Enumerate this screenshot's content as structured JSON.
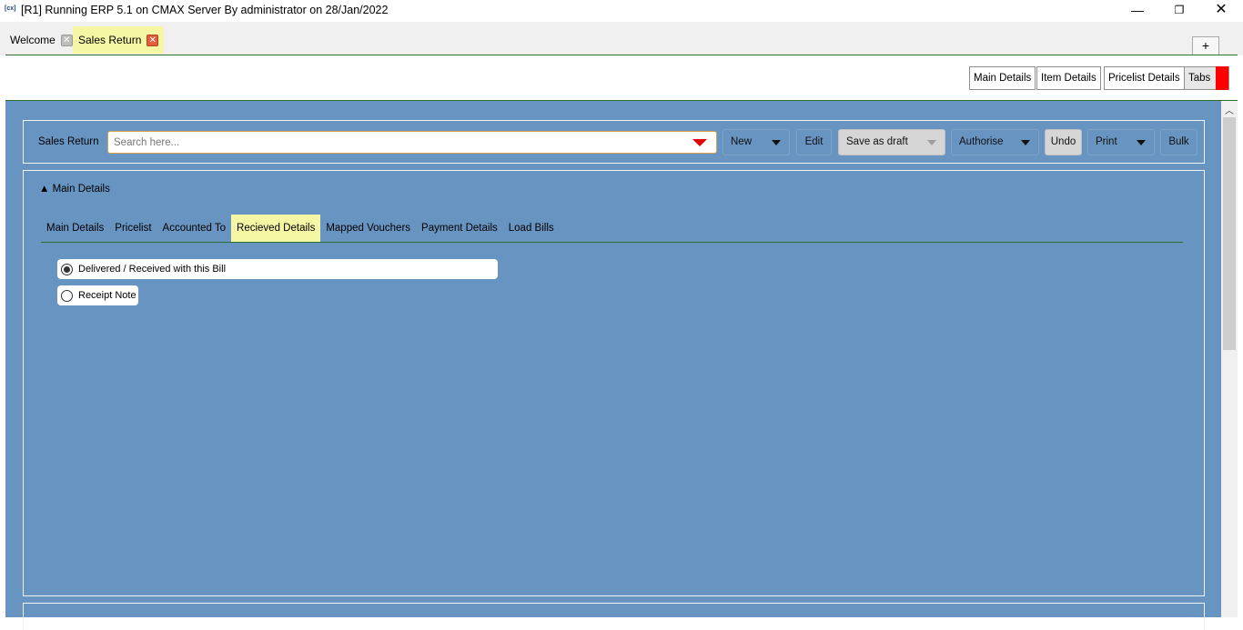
{
  "window": {
    "logo": "[cx]",
    "title": "[R1] Running ERP 5.1 on CMAX Server By administrator on 28/Jan/2022",
    "minimize": "—",
    "maximize": "❐",
    "close": "✕"
  },
  "doc_tabs": [
    {
      "label": "Welcome",
      "close": "✕"
    },
    {
      "label": "Sales Return",
      "close": "✕",
      "active": true
    }
  ],
  "add_tab": "+",
  "page_nav": {
    "main_details": "Main Details",
    "item_details": "Item Details",
    "pricelist_details": "Pricelist Details",
    "tabs": "Tabs"
  },
  "action_bar": {
    "label": "Sales Return",
    "search_placeholder": "Search here...",
    "buttons": {
      "new": "New",
      "edit": "Edit",
      "save_as_draft": "Save as draft",
      "authorise": "Authorise",
      "undo": "Undo",
      "print": "Print",
      "bulk": "Bulk"
    }
  },
  "details": {
    "toggle": "▲ Main Details",
    "tabs": [
      "Main Details",
      "Pricelist",
      "Accounted To",
      "Recieved Details",
      "Mapped Vouchers",
      "Payment Details",
      "Load Bills"
    ],
    "active_tab": "Recieved Details",
    "options": [
      {
        "label": "Delivered / Received with this Bill",
        "selected": true
      },
      {
        "label": "Receipt Note",
        "selected": false
      }
    ]
  },
  "colors": {
    "content_bg": "#6794c1",
    "active_tab_bg": "#f6f7a5",
    "accent_line": "#2f6e32",
    "marker_red": "#ff0000"
  }
}
